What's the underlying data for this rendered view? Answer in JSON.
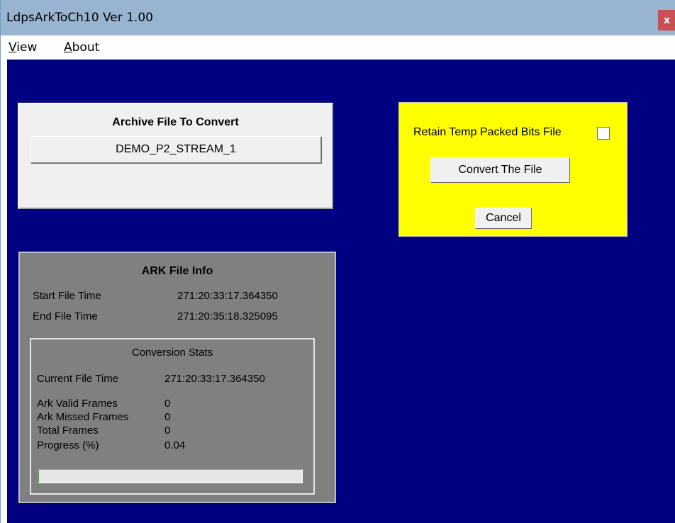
{
  "window": {
    "title": "LdpsArkToCh10 Ver 1.00",
    "close_label": "x",
    "close_color": "#c75050",
    "titlebar_color": "#99b4d1",
    "client_color": "#000080"
  },
  "menu": {
    "items": [
      {
        "label": "View",
        "mnemonic": "V"
      },
      {
        "label": "About",
        "mnemonic": "A"
      }
    ]
  },
  "archive": {
    "heading": "Archive File To Convert",
    "file_button_label": "DEMO_P2_STREAM_1"
  },
  "convert_panel": {
    "panel_color": "#ffff00",
    "retain_label": "Retain Temp Packed Bits File",
    "retain_checked": false,
    "convert_label": "Convert The File",
    "cancel_label": "Cancel"
  },
  "ark_info": {
    "heading": "ARK File Info",
    "start_label": "Start File Time",
    "start_value": "271:20:33:17.364350",
    "end_label": "End File Time",
    "end_value": "271:20:35:18.325095"
  },
  "stats": {
    "heading": "Conversion Stats",
    "current_label": "Current File Time",
    "current_value": "271:20:33:17.364350",
    "valid_label": "Ark Valid Frames",
    "valid_value": "0",
    "missed_label": "Ark Missed Frames",
    "missed_value": "0",
    "total_label": "Total Frames",
    "total_value": "0",
    "progress_label": "Progress (%)",
    "progress_value": "0.04",
    "progress_fraction": 0.0004
  }
}
